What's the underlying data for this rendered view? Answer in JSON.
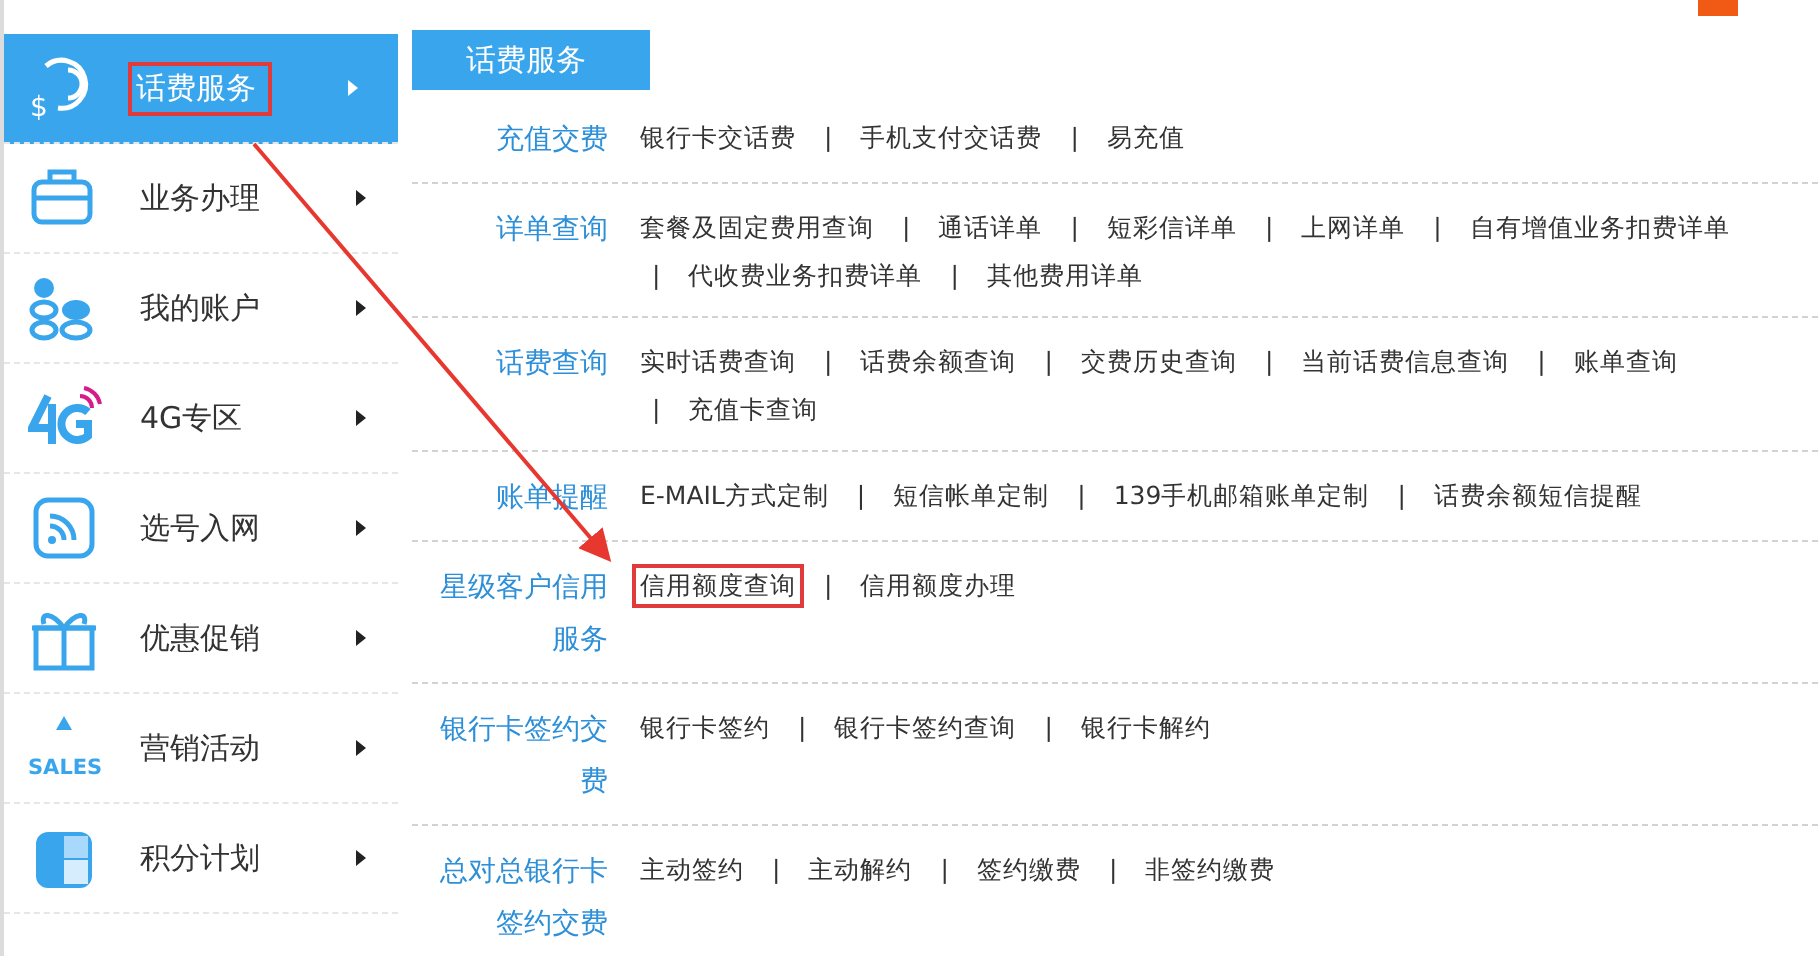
{
  "sidebar": {
    "items": [
      {
        "icon_text": "$",
        "label": "话费服务",
        "selected": true,
        "highlighted": true
      },
      {
        "label": "业务办理",
        "selected": false,
        "highlighted": false
      },
      {
        "label": "我的账户",
        "selected": false,
        "highlighted": false
      },
      {
        "label": "4G专区",
        "selected": false,
        "highlighted": false
      },
      {
        "label": "选号入网",
        "selected": false,
        "highlighted": false
      },
      {
        "label": "优惠促销",
        "selected": false,
        "highlighted": false
      },
      {
        "icon_text": "SALES",
        "label": "营销活动",
        "selected": false,
        "highlighted": false
      },
      {
        "label": "积分计划",
        "selected": false,
        "highlighted": false
      }
    ]
  },
  "panel": {
    "heading": "话费服务",
    "separator": "|",
    "sections": [
      {
        "title": "充值交费",
        "links": [
          {
            "text": "银行卡交话费",
            "highlighted": false
          },
          {
            "text": "手机支付交话费",
            "highlighted": false
          },
          {
            "text": "易充值",
            "highlighted": false
          }
        ]
      },
      {
        "title": "详单查询",
        "links": [
          {
            "text": "套餐及固定费用查询",
            "highlighted": false
          },
          {
            "text": "通话详单",
            "highlighted": false
          },
          {
            "text": "短彩信详单",
            "highlighted": false
          },
          {
            "text": "上网详单",
            "highlighted": false
          },
          {
            "text": "自有增值业务扣费详单",
            "highlighted": false
          },
          {
            "text": "代收费业务扣费详单",
            "highlighted": false
          },
          {
            "text": "其他费用详单",
            "highlighted": false
          }
        ]
      },
      {
        "title": "话费查询",
        "links": [
          {
            "text": "实时话费查询",
            "highlighted": false
          },
          {
            "text": "话费余额查询",
            "highlighted": false
          },
          {
            "text": "交费历史查询",
            "highlighted": false
          },
          {
            "text": "当前话费信息查询",
            "highlighted": false
          },
          {
            "text": "账单查询",
            "highlighted": false
          },
          {
            "text": "充值卡查询",
            "highlighted": false
          }
        ]
      },
      {
        "title": "账单提醒",
        "links": [
          {
            "text": "E-MAIL方式定制",
            "highlighted": false
          },
          {
            "text": "短信帐单定制",
            "highlighted": false
          },
          {
            "text": "139手机邮箱账单定制",
            "highlighted": false
          },
          {
            "text": "话费余额短信提醒",
            "highlighted": false
          }
        ]
      },
      {
        "title": "星级客户信用服务",
        "links": [
          {
            "text": "信用额度查询",
            "highlighted": true
          },
          {
            "text": "信用额度办理",
            "highlighted": false
          }
        ]
      },
      {
        "title": "银行卡签约交费",
        "links": [
          {
            "text": "银行卡签约",
            "highlighted": false
          },
          {
            "text": "银行卡签约查询",
            "highlighted": false
          },
          {
            "text": "银行卡解约",
            "highlighted": false
          }
        ]
      },
      {
        "title": "总对总银行卡签约交费",
        "links": [
          {
            "text": "主动签约",
            "highlighted": false
          },
          {
            "text": "主动解约",
            "highlighted": false
          },
          {
            "text": "签约缴费",
            "highlighted": false
          },
          {
            "text": "非签约缴费",
            "highlighted": false
          }
        ]
      }
    ]
  }
}
